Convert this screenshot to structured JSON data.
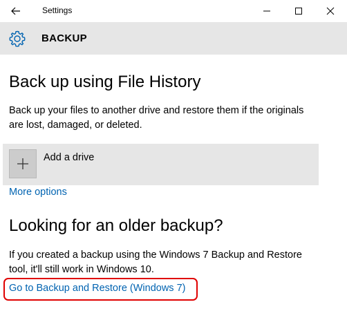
{
  "window": {
    "title": "Settings"
  },
  "header": {
    "title": "BACKUP",
    "icon": "gear-icon"
  },
  "file_history": {
    "heading": "Back up using File History",
    "description_line1": "Back up your files to another drive and restore them if the originals",
    "description_line2": "are lost, damaged, or deleted.",
    "add_drive_label": "Add a drive",
    "more_options_label": "More options"
  },
  "older_backup": {
    "heading": "Looking for an older backup?",
    "description_line1": "If you created a backup using the Windows 7 Backup and Restore",
    "description_line2": "tool, it'll still work in Windows 10.",
    "link_label": "Go to Backup and Restore (Windows 7)"
  },
  "colors": {
    "link": "#0063b1",
    "highlight": "#e00000",
    "band": "#e6e6e6"
  }
}
